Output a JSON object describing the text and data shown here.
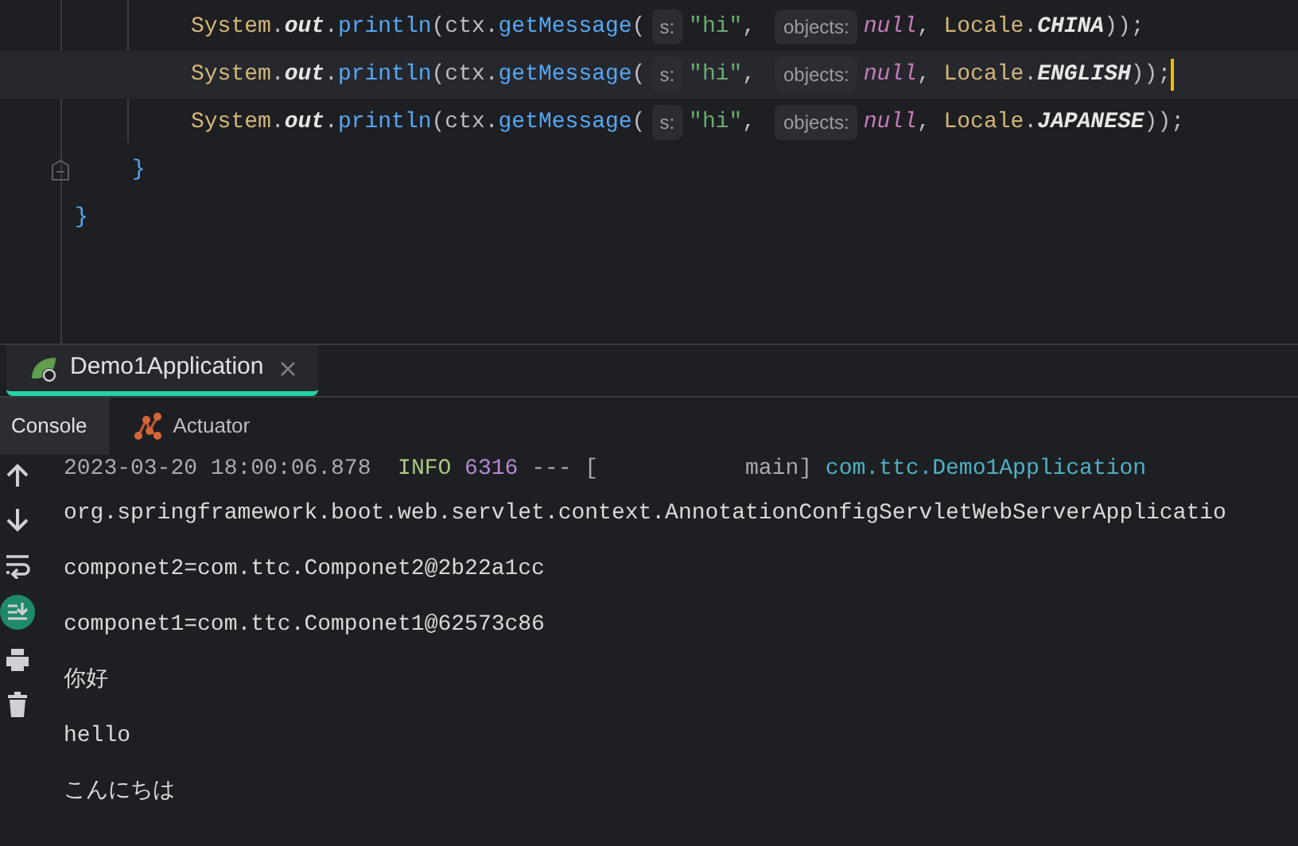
{
  "editor": {
    "blocks": [
      {
        "current": false,
        "caret": false,
        "fold": false,
        "closing": [
          {
            "kind": "brace",
            "text": "}"
          }
        ],
        "children": [
          {
            "current": false,
            "caret": false,
            "fold": true,
            "closing": [
              {
                "kind": "brace",
                "text": "}"
              }
            ],
            "children": [
              {
                "current": false,
                "caret": false,
                "tokens": [
                  {
                    "kind": "class",
                    "text": "System"
                  },
                  {
                    "kind": "plain",
                    "text": "."
                  },
                  {
                    "kind": "static",
                    "text": "out"
                  },
                  {
                    "kind": "plain",
                    "text": "."
                  },
                  {
                    "kind": "method",
                    "text": "println"
                  },
                  {
                    "kind": "plain",
                    "text": "(ctx."
                  },
                  {
                    "kind": "method",
                    "text": "getMessage"
                  },
                  {
                    "kind": "plain",
                    "text": "("
                  },
                  {
                    "kind": "hint",
                    "text": "s:"
                  },
                  {
                    "kind": "string",
                    "text": "\"hi\""
                  },
                  {
                    "kind": "plain",
                    "text": ", "
                  },
                  {
                    "kind": "hint",
                    "text": "objects:"
                  },
                  {
                    "kind": "keyword",
                    "text": "null"
                  },
                  {
                    "kind": "plain",
                    "text": ", "
                  },
                  {
                    "kind": "class",
                    "text": "Locale"
                  },
                  {
                    "kind": "plain",
                    "text": "."
                  },
                  {
                    "kind": "static",
                    "text": "CHINA"
                  },
                  {
                    "kind": "plain",
                    "text": "));"
                  }
                ]
              },
              {
                "current": true,
                "caret": true,
                "tokens": [
                  {
                    "kind": "class",
                    "text": "System"
                  },
                  {
                    "kind": "plain",
                    "text": "."
                  },
                  {
                    "kind": "static",
                    "text": "out"
                  },
                  {
                    "kind": "plain",
                    "text": "."
                  },
                  {
                    "kind": "method",
                    "text": "println"
                  },
                  {
                    "kind": "plain",
                    "text": "(ctx."
                  },
                  {
                    "kind": "method",
                    "text": "getMessage"
                  },
                  {
                    "kind": "plain",
                    "text": "("
                  },
                  {
                    "kind": "hint",
                    "text": "s:"
                  },
                  {
                    "kind": "string",
                    "text": "\"hi\""
                  },
                  {
                    "kind": "plain",
                    "text": ", "
                  },
                  {
                    "kind": "hint",
                    "text": "objects:"
                  },
                  {
                    "kind": "keyword",
                    "text": "null"
                  },
                  {
                    "kind": "plain",
                    "text": ", "
                  },
                  {
                    "kind": "class",
                    "text": "Locale"
                  },
                  {
                    "kind": "plain",
                    "text": "."
                  },
                  {
                    "kind": "static",
                    "text": "ENGLISH"
                  },
                  {
                    "kind": "plain",
                    "text": "));"
                  }
                ]
              },
              {
                "current": false,
                "caret": false,
                "tokens": [
                  {
                    "kind": "class",
                    "text": "System"
                  },
                  {
                    "kind": "plain",
                    "text": "."
                  },
                  {
                    "kind": "static",
                    "text": "out"
                  },
                  {
                    "kind": "plain",
                    "text": "."
                  },
                  {
                    "kind": "method",
                    "text": "println"
                  },
                  {
                    "kind": "plain",
                    "text": "(ctx."
                  },
                  {
                    "kind": "method",
                    "text": "getMessage"
                  },
                  {
                    "kind": "plain",
                    "text": "("
                  },
                  {
                    "kind": "hint",
                    "text": "s:"
                  },
                  {
                    "kind": "string",
                    "text": "\"hi\""
                  },
                  {
                    "kind": "plain",
                    "text": ", "
                  },
                  {
                    "kind": "hint",
                    "text": "objects:"
                  },
                  {
                    "kind": "keyword",
                    "text": "null"
                  },
                  {
                    "kind": "plain",
                    "text": ", "
                  },
                  {
                    "kind": "class",
                    "text": "Locale"
                  },
                  {
                    "kind": "plain",
                    "text": "."
                  },
                  {
                    "kind": "static",
                    "text": "JAPANESE"
                  },
                  {
                    "kind": "plain",
                    "text": "));"
                  }
                ]
              }
            ]
          }
        ]
      }
    ]
  },
  "run_tabs": [
    {
      "label": "Demo1Application",
      "selected": true
    }
  ],
  "console_tabs": [
    {
      "label": "Console",
      "selected": true,
      "kind": "console"
    },
    {
      "label": "Actuator",
      "selected": false,
      "kind": "actuator"
    }
  ],
  "toolbar": [
    {
      "kind": "up",
      "on": false
    },
    {
      "kind": "down",
      "on": false
    },
    {
      "kind": "wrap",
      "on": false
    },
    {
      "kind": "scroll",
      "on": true
    },
    {
      "kind": "print",
      "on": false
    },
    {
      "kind": "trash",
      "on": false
    }
  ],
  "console": [
    {
      "segments": [
        {
          "kind": "dim",
          "text": "2023-03-20 18:00:06.878 "
        },
        {
          "kind": "info",
          "text": " INFO"
        },
        {
          "kind": "pid",
          "text": " 6316"
        },
        {
          "kind": "dim",
          "text": " --- [           main]"
        },
        {
          "kind": "logger",
          "text": " com.ttc.Demo1Application"
        }
      ]
    },
    {
      "segments": [
        {
          "kind": "out",
          "text": "org.springframework.boot.web.servlet.context.AnnotationConfigServletWebServerApplicatio"
        }
      ]
    },
    {
      "segments": [
        {
          "kind": "out",
          "text": "componet2=com.ttc.Componet2@2b22a1cc"
        }
      ]
    },
    {
      "segments": [
        {
          "kind": "out",
          "text": "componet1=com.ttc.Componet1@62573c86"
        }
      ]
    },
    {
      "segments": [
        {
          "kind": "out",
          "text": "你好"
        }
      ]
    },
    {
      "segments": [
        {
          "kind": "out",
          "text": "hello"
        }
      ]
    },
    {
      "segments": [
        {
          "kind": "out",
          "text": "こんにちは"
        }
      ]
    }
  ]
}
